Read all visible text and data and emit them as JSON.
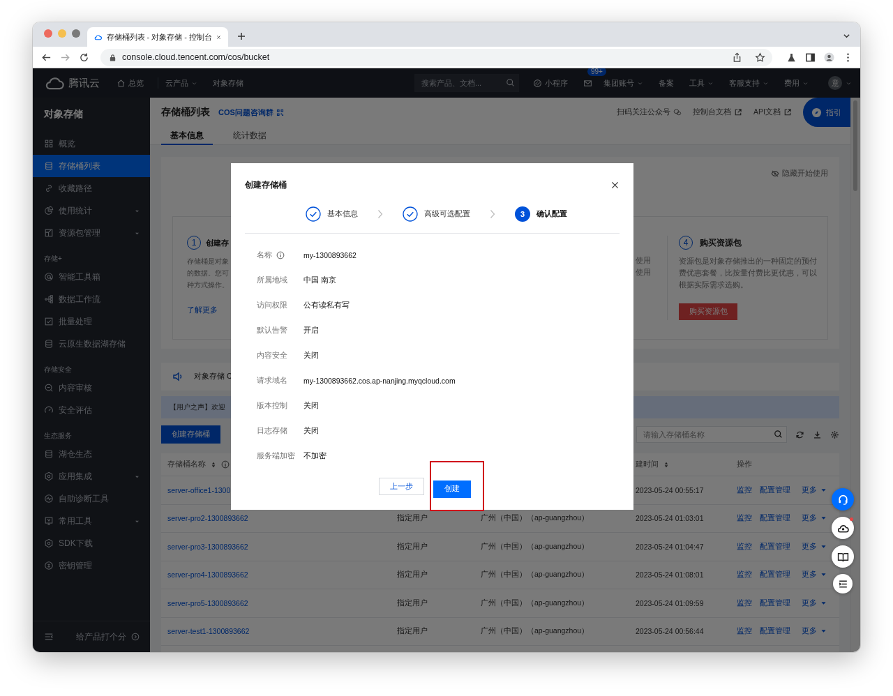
{
  "browser": {
    "tab_title": "存储桶列表 - 对象存储 - 控制台",
    "url": "console.cloud.tencent.com/cos/bucket"
  },
  "top_nav": {
    "brand": "腾讯云",
    "left_items": [
      {
        "label": "总览",
        "kind": "home"
      },
      {
        "label": "云产品",
        "kind": "dropdown"
      },
      {
        "label": "对象存储",
        "kind": "plain"
      }
    ],
    "search": {
      "placeholder": "搜索产品、文档..."
    },
    "right_items": [
      {
        "label": "小程序",
        "kind": "miniapp"
      },
      {
        "kind": "mail",
        "badge": "99+"
      },
      {
        "label": "集团账号",
        "kind": "dropdown"
      },
      {
        "label": "备案",
        "kind": "plain"
      },
      {
        "label": "工具",
        "kind": "dropdown"
      },
      {
        "label": "客服支持",
        "kind": "dropdown"
      },
      {
        "label": "费用",
        "kind": "dropdown"
      }
    ],
    "avatar": {
      "initial": "意"
    }
  },
  "sidebar": {
    "title": "对象存储",
    "sections": [
      {
        "items": [
          {
            "label": "概览",
            "selected": false,
            "expandable": false
          },
          {
            "label": "存储桶列表",
            "selected": true,
            "expandable": false
          },
          {
            "label": "收藏路径",
            "selected": false,
            "expandable": false
          },
          {
            "label": "使用统计",
            "selected": false,
            "expandable": true
          },
          {
            "label": "资源包管理",
            "selected": false,
            "expandable": true
          }
        ]
      },
      {
        "heading": "存储+",
        "items": [
          {
            "label": "智能工具箱",
            "selected": false,
            "expandable": false
          },
          {
            "label": "数据工作流",
            "selected": false,
            "expandable": false
          },
          {
            "label": "批量处理",
            "selected": false,
            "expandable": false
          },
          {
            "label": "云原生数据湖存储",
            "selected": false,
            "expandable": false
          }
        ]
      },
      {
        "heading": "存储安全",
        "items": [
          {
            "label": "内容审核",
            "selected": false,
            "expandable": false
          },
          {
            "label": "安全评估",
            "selected": false,
            "expandable": false
          }
        ]
      },
      {
        "heading": "生态服务",
        "items": [
          {
            "label": "湖仓生态",
            "selected": false,
            "expandable": false
          },
          {
            "label": "应用集成",
            "selected": false,
            "expandable": true
          },
          {
            "label": "自助诊断工具",
            "selected": false,
            "expandable": false
          },
          {
            "label": "常用工具",
            "selected": false,
            "expandable": true
          },
          {
            "label": "SDK下载",
            "selected": false,
            "expandable": false
          },
          {
            "label": "密钥管理",
            "selected": false,
            "expandable": false
          }
        ]
      }
    ],
    "footer": {
      "label": "给产品打个分"
    }
  },
  "page_header": {
    "title": "存储桶列表",
    "group_link": "COS问题咨询群",
    "links": [
      {
        "label": "扫码关注公众号",
        "kind": "wechat"
      },
      {
        "label": "控制台文档",
        "kind": "external"
      },
      {
        "label": "API文档",
        "kind": "external"
      }
    ],
    "guide_button": "指引",
    "tabs": [
      {
        "label": "基本信息",
        "selected": true
      },
      {
        "label": "统计数据",
        "selected": false
      }
    ]
  },
  "getting_started": {
    "hide_link": "隐藏开始使用",
    "cards": [
      {
        "kind": "link",
        "number": "1",
        "title": "创建存",
        "lines": [
          "存储桶是对象",
          "的数据。您可",
          "种方式操作。"
        ],
        "link": "了解更多"
      },
      {
        "kind": "partial",
        "lines": [
          "使用",
          "使用"
        ]
      },
      {
        "kind": "button",
        "number": "4",
        "title": "购买资源包",
        "description": "资源包是对象存储推出的一种固定的预付费优惠套餐，比按量付费比更优惠，可以根据实际需求选购。",
        "button": "购买资源包"
      }
    ]
  },
  "announcement": {
    "text": "对象存储 C"
  },
  "voice_banner": {
    "text": "【用户之声】欢迎"
  },
  "toolbar": {
    "create_button": "创建存储桶",
    "search": {
      "placeholder": "请输入存储桶名称"
    }
  },
  "table": {
    "header": {
      "name": {
        "label": "存储桶名称",
        "sortable": true
      },
      "created_at": {
        "label": "建时间",
        "sortable": true
      },
      "actions": {
        "label": "操作",
        "sortable": false
      }
    },
    "rows": [
      {
        "name": "server-office1-1300",
        "created_at": "2023-05-24 00:55:17",
        "actions": [
          "监控",
          "配置管理",
          "更多"
        ]
      },
      {
        "name": "server-pro2-1300893662",
        "permission": "指定用户",
        "region": "广州（中国）（ap-guangzhou）",
        "created_at": "2023-05-24 01:03:01",
        "actions": [
          "监控",
          "配置管理",
          "更多"
        ]
      },
      {
        "name": "server-pro3-1300893662",
        "permission": "指定用户",
        "region": "广州（中国）（ap-guangzhou）",
        "created_at": "2023-05-24 01:04:47",
        "actions": [
          "监控",
          "配置管理",
          "更多"
        ]
      },
      {
        "name": "server-pro4-1300893662",
        "permission": "指定用户",
        "region": "广州（中国）（ap-guangzhou）",
        "created_at": "2023-05-24 01:08:01",
        "actions": [
          "监控",
          "配置管理",
          "更多"
        ]
      },
      {
        "name": "server-pro5-1300893662",
        "permission": "指定用户",
        "region": "广州（中国）（ap-guangzhou）",
        "created_at": "2023-05-24 01:09:59",
        "actions": [
          "监控",
          "配置管理",
          "更多"
        ]
      },
      {
        "name": "server-test1-1300893662",
        "permission": "指定用户",
        "region": "广州（中国）（ap-guangzhou）",
        "created_at": "2023-05-24 00:56:44",
        "actions": [
          "监控",
          "配置管理",
          "更多"
        ]
      }
    ]
  },
  "modal": {
    "title": "创建存储桶",
    "steps": [
      {
        "label": "基本信息",
        "completed": true
      },
      {
        "label": "高级可选配置",
        "completed": true
      },
      {
        "label": "确认配置",
        "number": "3",
        "completed": false
      }
    ],
    "fields": [
      {
        "label": "名称",
        "value": "my-1300893662",
        "info": true
      },
      {
        "label": "所属地域",
        "value": "中国 南京",
        "info": false
      },
      {
        "label": "访问权限",
        "value": "公有读私有写",
        "info": false
      },
      {
        "label": "默认告警",
        "value": "开启",
        "info": false
      },
      {
        "label": "内容安全",
        "value": "关闭",
        "info": false
      },
      {
        "label": "请求域名",
        "value": "my-1300893662.cos.ap-nanjing.myqcloud.com",
        "info": false
      },
      {
        "label": "版本控制",
        "value": "关闭",
        "info": false
      },
      {
        "label": "日志存储",
        "value": "关闭",
        "info": false
      },
      {
        "label": "服务端加密",
        "value": "不加密",
        "info": false
      }
    ],
    "buttons": [
      {
        "label": "上一步",
        "primary": false,
        "highlighted": false
      },
      {
        "label": "创建",
        "primary": true,
        "highlighted": true
      }
    ]
  }
}
